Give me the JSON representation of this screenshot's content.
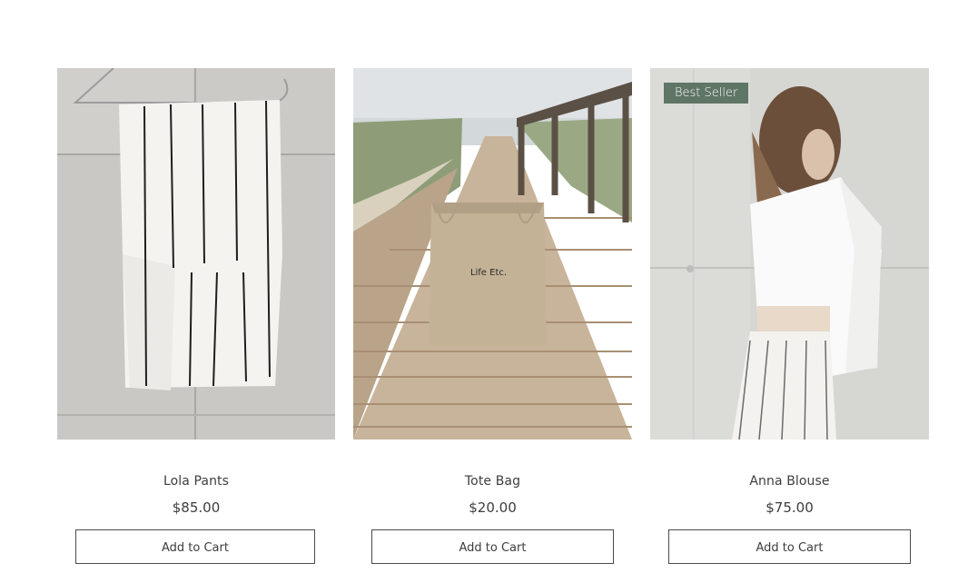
{
  "products": [
    {
      "name": "Lola Pants",
      "price": "$85.00",
      "button_label": "Add to Cart",
      "image": "striped-pants-on-hanger"
    },
    {
      "name": "Tote Bag",
      "price": "$20.00",
      "button_label": "Add to Cart",
      "image": "tote-bag-on-boardwalk",
      "bag_print": "Life Etc."
    },
    {
      "name": "Anna Blouse",
      "price": "$75.00",
      "button_label": "Add to Cart",
      "image": "woman-in-white-blouse",
      "ribbon": "Best Seller"
    }
  ],
  "colors": {
    "ribbon_bg": "#5f7566",
    "button_border": "#4b4b4b",
    "text": "#3d3d3d"
  }
}
